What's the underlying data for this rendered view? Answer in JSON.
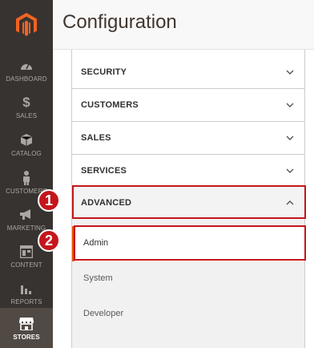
{
  "header": {
    "title": "Configuration"
  },
  "sidebar": {
    "items": [
      {
        "label": "DASHBOARD"
      },
      {
        "label": "SALES"
      },
      {
        "label": "CATALOG"
      },
      {
        "label": "CUSTOMERS"
      },
      {
        "label": "MARKETING"
      },
      {
        "label": "CONTENT"
      },
      {
        "label": "REPORTS"
      },
      {
        "label": "STORES",
        "active": true
      }
    ]
  },
  "sections": [
    {
      "label": "SECURITY",
      "expanded": false
    },
    {
      "label": "CUSTOMERS",
      "expanded": false
    },
    {
      "label": "SALES",
      "expanded": false
    },
    {
      "label": "SERVICES",
      "expanded": false
    },
    {
      "label": "ADVANCED",
      "expanded": true
    }
  ],
  "advanced_items": [
    {
      "label": "Admin",
      "selected": true
    },
    {
      "label": "System"
    },
    {
      "label": "Developer"
    }
  ],
  "callouts": {
    "one": "1",
    "two": "2"
  },
  "colors": {
    "sidebar": "#373330",
    "accent": "#eb5202",
    "callout": "#c4161c"
  }
}
